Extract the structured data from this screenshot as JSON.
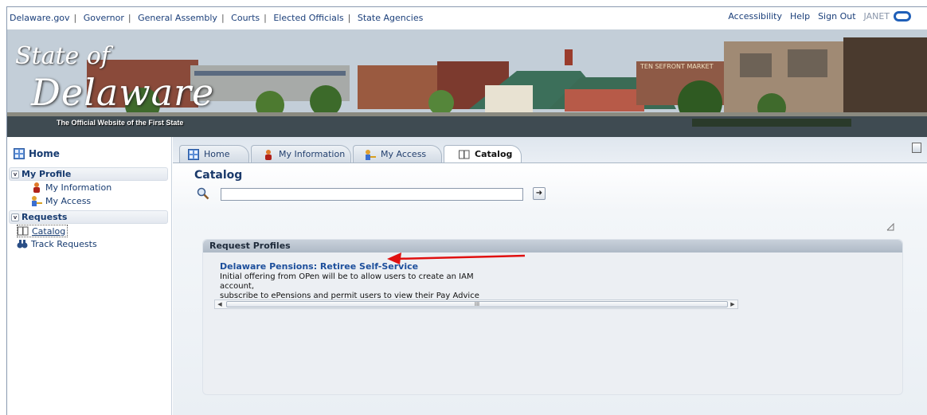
{
  "topbar": {
    "left_links": [
      "Delaware.gov",
      "Governor",
      "General Assembly",
      "Courts",
      "Elected Officials",
      "State Agencies"
    ],
    "accessibility": "Accessibility",
    "help": "Help",
    "sign_out": "Sign Out",
    "user": "JANET"
  },
  "banner": {
    "state_of": "State of",
    "delaware": "Delaware",
    "tagline": "The Official Website of the First State"
  },
  "sidebar": {
    "home": "Home",
    "my_profile": "My Profile",
    "my_information": "My Information",
    "my_access": "My Access",
    "requests": "Requests",
    "catalog": "Catalog",
    "track_requests": "Track Requests"
  },
  "tabs": {
    "home": "Home",
    "my_information": "My Information",
    "my_access": "My Access",
    "catalog": "Catalog"
  },
  "main": {
    "title": "Catalog",
    "search_value": "",
    "request_profiles_header": "Request Profiles",
    "profile_link": "Delaware Pensions: Retiree Self-Service",
    "profile_desc_line1": "Initial offering from OPen will be to allow users to create an IAM account,",
    "profile_desc_line2": "subscribe to ePensions and permit users to view their Pay Advice online.",
    "scroll_grip": "III"
  },
  "colors": {
    "link_blue": "#1d4f9c",
    "annotation_red": "#e01010"
  }
}
